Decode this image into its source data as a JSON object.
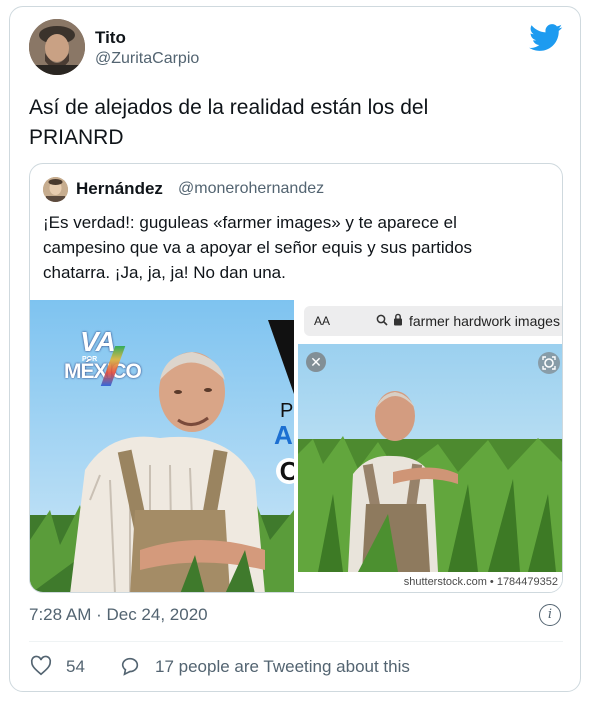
{
  "author": {
    "name": "Tito",
    "handle": "@ZuritaCarpio"
  },
  "tweet": {
    "text_line1": "Así de alejados de la realidad están los del",
    "text_line2": "PRIANRD"
  },
  "quoted": {
    "name": "Hernández",
    "handle": "@monerohernandez",
    "text_line1": "¡Es verdad!: guguleas «farmer images» y te aparece el",
    "text_line2": "campesino que va a apoyar el señor equis y sus partidos",
    "text_line3": "chatarra. ¡Ja, ja, ja! No dan una.",
    "poster": {
      "logo_va": "VA",
      "logo_por": "POR",
      "logo_mexico": "MÉXICO",
      "cut_letters": [
        "P",
        "A",
        "C"
      ]
    },
    "browser": {
      "aa_label": "AA",
      "url_text": "farmer hardwork images",
      "close_glyph": "✕",
      "credit": "shutterstock.com • 1784479352"
    }
  },
  "meta": {
    "timestamp": "7:28 AM · Dec 24, 2020",
    "info_glyph": "i",
    "likes": "54",
    "conversation": "17 people are Tweeting about this"
  },
  "colors": {
    "twitter_blue": "#1d9bf0",
    "secondary_text": "#536471"
  }
}
